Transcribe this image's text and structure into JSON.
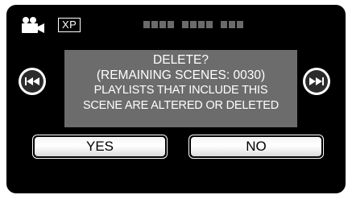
{
  "status_bar": {
    "mode_icon": "video-camera-icon",
    "quality": "XP"
  },
  "dialog": {
    "lines": [
      "DELETE?",
      "(REMAINING SCENES: 0030)",
      "PLAYLISTS THAT INCLUDE THIS",
      "SCENE ARE ALTERED OR DELETED"
    ]
  },
  "navigation": {
    "prev_icon": "skip-previous-icon",
    "next_icon": "skip-next-icon"
  },
  "buttons": {
    "yes_label": "YES",
    "no_label": "NO"
  },
  "colors": {
    "screen_bg": "#000000",
    "dialog_bg": "#6c6c6c",
    "text": "#ffffff",
    "button_face": "#ffffff"
  }
}
